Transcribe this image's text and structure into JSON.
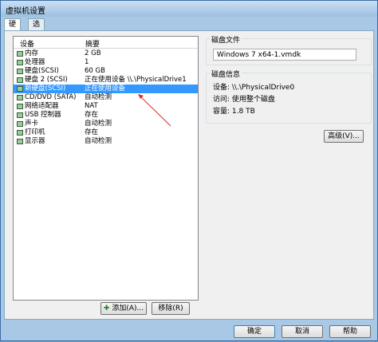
{
  "window": {
    "title": "虚拟机设置"
  },
  "tabs": [
    {
      "label": "硬件"
    },
    {
      "label": "选项"
    }
  ],
  "device_list": {
    "headers": {
      "device": "设备",
      "summary": "摘要"
    },
    "rows": [
      {
        "name": "内存",
        "summary": "2 GB",
        "icon": "memory-icon"
      },
      {
        "name": "处理器",
        "summary": "1",
        "icon": "cpu-icon"
      },
      {
        "name": "硬盘(SCSI)",
        "summary": "60 GB",
        "icon": "hard-disk-icon"
      },
      {
        "name": "硬盘 2 (SCSI)",
        "summary": "正在使用设备 \\\\.\\PhysicalDrive1",
        "icon": "hard-disk-icon"
      },
      {
        "name": "新硬盘(SCSI)",
        "summary": "正在使用设备",
        "icon": "hard-disk-icon",
        "selected": true
      },
      {
        "name": "CD/DVD (SATA)",
        "summary": "自动检测",
        "icon": "cd-dvd-icon"
      },
      {
        "name": "网络适配器",
        "summary": "NAT",
        "icon": "network-adapter-icon"
      },
      {
        "name": "USB 控制器",
        "summary": "存在",
        "icon": "usb-icon"
      },
      {
        "name": "声卡",
        "summary": "自动检测",
        "icon": "sound-card-icon"
      },
      {
        "name": "打印机",
        "summary": "存在",
        "icon": "printer-icon"
      },
      {
        "name": "显示器",
        "summary": "自动检测",
        "icon": "display-icon"
      }
    ]
  },
  "buttons": {
    "add": "添加(A)...",
    "remove": "移除(R)",
    "advanced": "高级(V)...",
    "ok": "确定",
    "cancel": "取消",
    "help": "帮助"
  },
  "disk_file": {
    "label": "磁盘文件",
    "value": "Windows 7 x64-1.vmdk"
  },
  "disk_info": {
    "label": "磁盘信息",
    "device": "设备: \\\\.\\PhysicalDrive0",
    "access": "访问: 使用整个磁盘",
    "capacity": "容量: 1.8 TB"
  },
  "colors": {
    "selection": "#3399ff",
    "annotation_arrow": "#d03030"
  }
}
